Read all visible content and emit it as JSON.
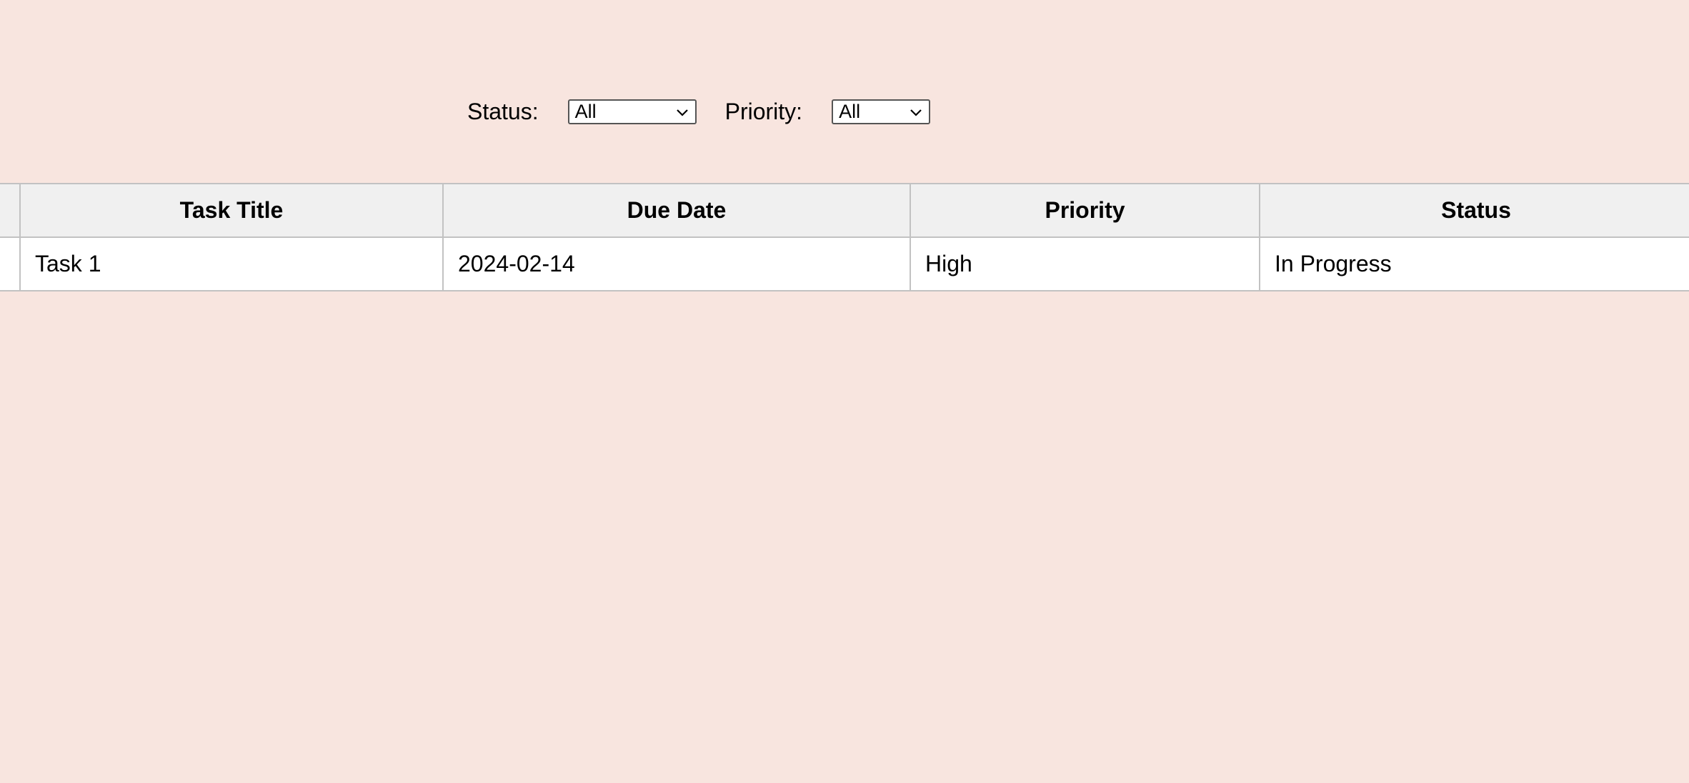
{
  "filters": {
    "status": {
      "label": "Status:",
      "selected": "All"
    },
    "priority": {
      "label": "Priority:",
      "selected": "All"
    }
  },
  "table": {
    "headers": {
      "task_title": "Task Title",
      "due_date": "Due Date",
      "priority": "Priority",
      "status": "Status"
    },
    "rows": [
      {
        "task_title": "Task 1",
        "due_date": "2024-02-14",
        "priority": "High",
        "status": "In Progress"
      }
    ]
  },
  "colors": {
    "page_background": "#f8e5df",
    "header_background": "#f0f0f0",
    "cell_background": "#ffffff",
    "border": "#c2c2c2"
  },
  "icons": {
    "dropdown": "chevron-down-icon"
  }
}
